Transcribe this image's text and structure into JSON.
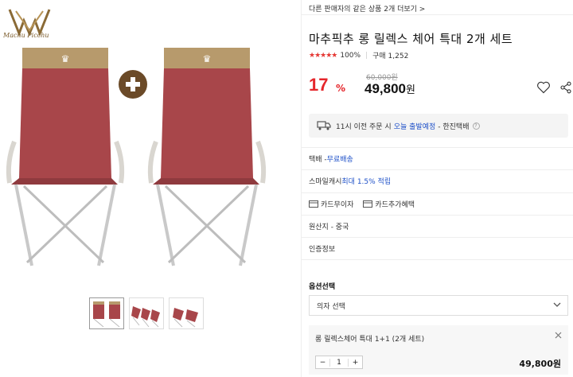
{
  "brand": {
    "logo_text": "Machu Picchu"
  },
  "seller_link": "다른 판매자의 같은 상품 2개 더보기 >",
  "product": {
    "title": "마추픽추 롱 릴렉스 체어 특대 2개 세트",
    "rating_stars": "★★★★★",
    "rating_pct": "100%",
    "purchase_count": "구매 1,252"
  },
  "price": {
    "discount_num": "17",
    "discount_pct": "%",
    "original": "60,000원",
    "sale": "49,800",
    "sale_unit": "원"
  },
  "delivery": {
    "prefix": "11시 이전 주문 시",
    "highlight": "오늘 출발예정",
    "suffix": "- 한진택배",
    "help": "?"
  },
  "rows": {
    "shipping_label": "택배 - ",
    "shipping_value": "무료배송",
    "cash_label": "스마일캐시 ",
    "cash_value": "최대 1.5% 적립",
    "card_free": "카드무이자",
    "card_benefit": "카드추가혜택",
    "origin": "원산지 - 중국",
    "certification": "인증정보"
  },
  "options": {
    "title": "옵션선택",
    "select_value": "의자 선택",
    "chosen_name": "롱 릴렉스체어 특대 1+1 (2개 세트)",
    "qty_minus": "−",
    "qty": "1",
    "qty_plus": "+",
    "chosen_price": "49,800원"
  },
  "icons": {
    "heart": "heart-icon",
    "share": "share-icon",
    "truck": "truck-icon",
    "close": "close-icon",
    "chevron": "chevron-down-icon",
    "card": "card-icon",
    "plus": "plus-icon"
  },
  "colors": {
    "accent_red": "#e5262b",
    "link_blue": "#1e50c8",
    "chair_red": "#a8464a",
    "chair_top": "#b79a6c"
  }
}
